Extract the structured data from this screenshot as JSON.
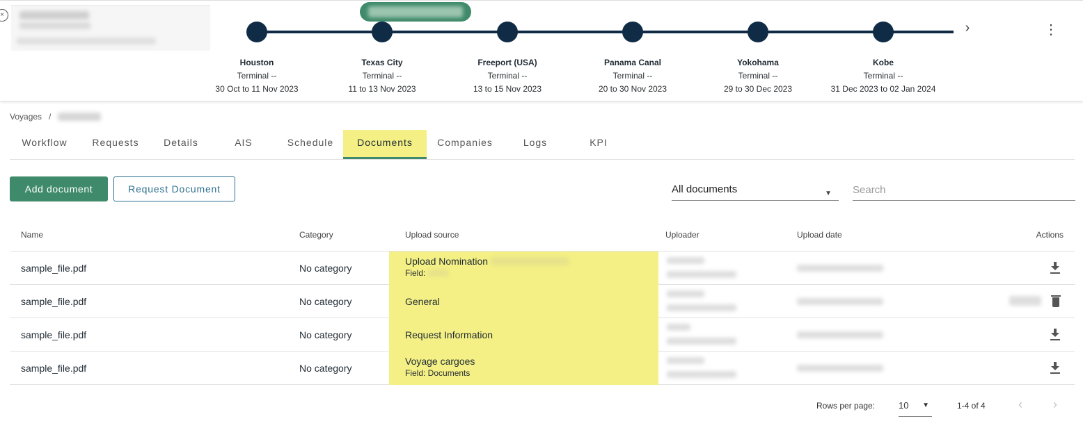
{
  "timeline": {
    "stops": [
      {
        "port": "Houston",
        "terminal": "Terminal --",
        "dates": "30 Oct to 11 Nov 2023"
      },
      {
        "port": "Texas City",
        "terminal": "Terminal --",
        "dates": "11 to 13 Nov 2023"
      },
      {
        "port": "Freeport (USA)",
        "terminal": "Terminal --",
        "dates": "13 to 15 Nov 2023"
      },
      {
        "port": "Panama Canal",
        "terminal": "Terminal --",
        "dates": "20 to 30 Nov 2023"
      },
      {
        "port": "Yokohama",
        "terminal": "Terminal --",
        "dates": "29 to 30 Dec 2023"
      },
      {
        "port": "Kobe",
        "terminal": "Terminal --",
        "dates": "31 Dec 2023 to 02 Jan 2024"
      }
    ],
    "next_icon": "chevron-right-icon",
    "menu_icon": "more-vertical-icon"
  },
  "breadcrumb": {
    "root": "Voyages",
    "separator": "/"
  },
  "tabs": [
    {
      "label": "Workflow",
      "active": false
    },
    {
      "label": "Requests",
      "active": false
    },
    {
      "label": "Details",
      "active": false
    },
    {
      "label": "AIS",
      "active": false
    },
    {
      "label": "Schedule",
      "active": false
    },
    {
      "label": "Documents",
      "active": true
    },
    {
      "label": "Companies",
      "active": false
    },
    {
      "label": "Logs",
      "active": false
    },
    {
      "label": "KPI",
      "active": false
    }
  ],
  "toolbar": {
    "add_label": "Add document",
    "request_label": "Request Document",
    "filter_value": "All documents",
    "search_placeholder": "Search"
  },
  "table": {
    "headers": {
      "name": "Name",
      "category": "Category",
      "source": "Upload source",
      "uploader": "Uploader",
      "date": "Upload date",
      "actions": "Actions"
    },
    "rows": [
      {
        "name": "sample_file.pdf",
        "category": "No category",
        "source": "Upload Nomination",
        "field": "Field:",
        "action": "download-icon"
      },
      {
        "name": "sample_file.pdf",
        "category": "No category",
        "source": "General",
        "field": "",
        "action": "delete-icon"
      },
      {
        "name": "sample_file.pdf",
        "category": "No category",
        "source": "Request Information",
        "field": "",
        "action": "download-icon"
      },
      {
        "name": "sample_file.pdf",
        "category": "No category",
        "source": "Voyage cargoes",
        "field": "Field: Documents",
        "action": "download-icon"
      }
    ]
  },
  "pagination": {
    "rows_per_page_label": "Rows per page:",
    "rows_per_page": "10",
    "range": "1-4 of 4"
  },
  "colors": {
    "primary": "#3f8a6a",
    "navy": "#0f2b46",
    "highlight": "#f4f085",
    "link": "#2d6f8f"
  }
}
